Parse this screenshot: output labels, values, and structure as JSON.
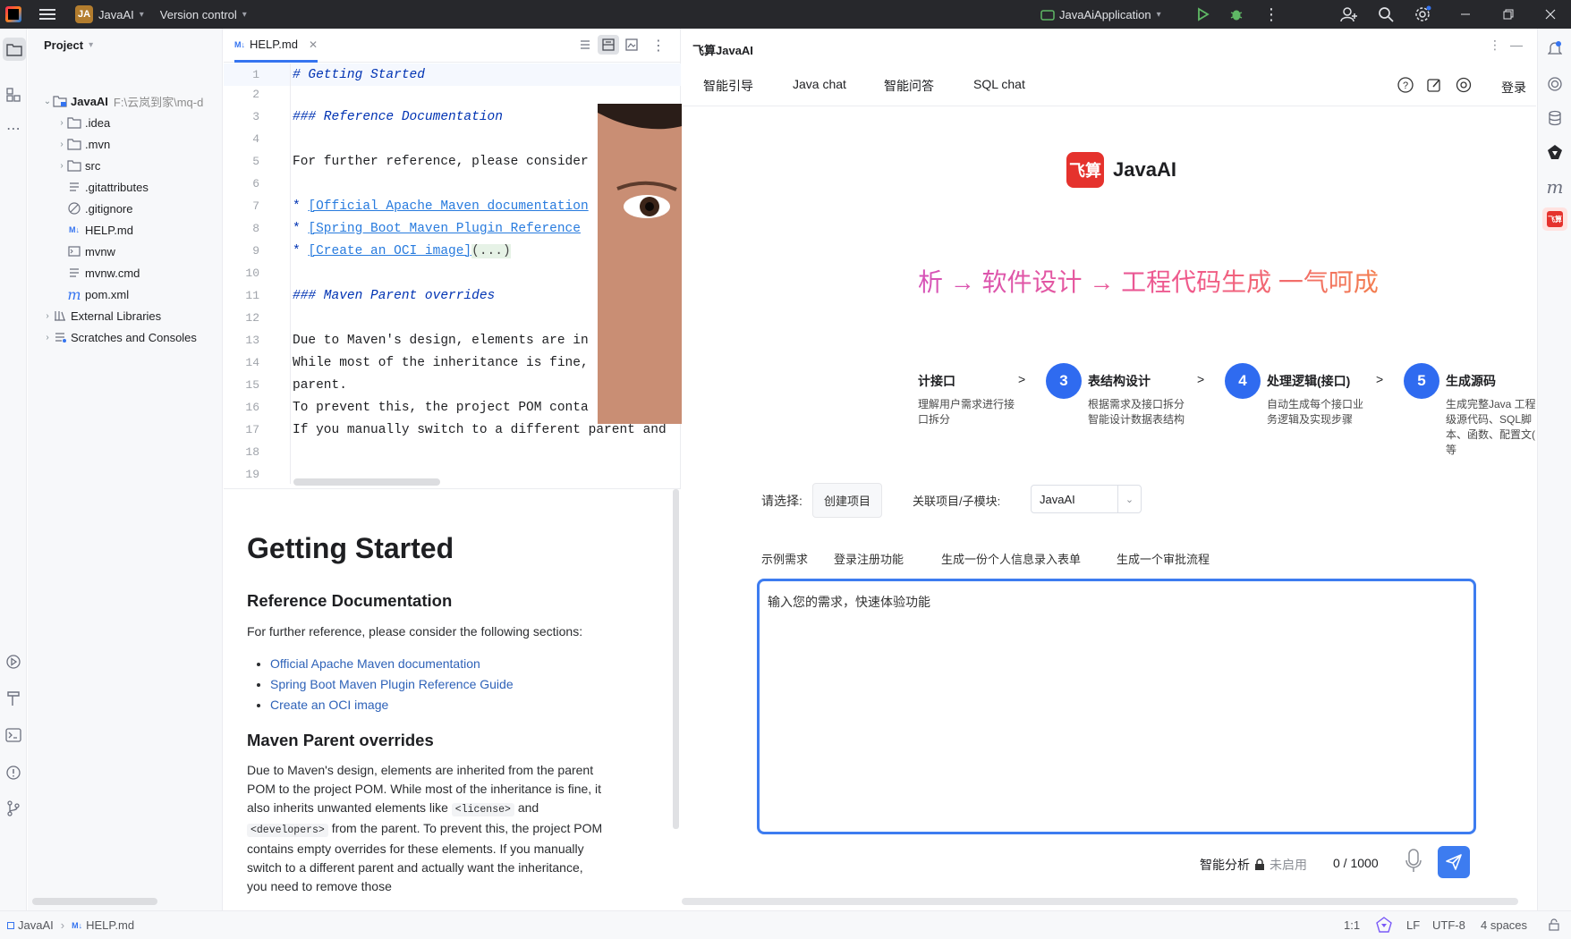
{
  "topbar": {
    "project_badge": "JA",
    "project_name": "JavaAI",
    "vcs_label": "Version control",
    "run_config": "JavaAiApplication"
  },
  "project_panel": {
    "title": "Project",
    "root_name": "JavaAI",
    "root_path": "F:\\云岚到家\\mq-d",
    "items": [
      {
        "label": ".idea"
      },
      {
        "label": ".mvn"
      },
      {
        "label": "src"
      },
      {
        "label": ".gitattributes"
      },
      {
        "label": ".gitignore"
      },
      {
        "label": "HELP.md"
      },
      {
        "label": "mvnw"
      },
      {
        "label": "mvnw.cmd"
      },
      {
        "label": "pom.xml"
      },
      {
        "label": "External Libraries"
      },
      {
        "label": "Scratches and Consoles"
      }
    ]
  },
  "editor": {
    "tab_label": "HELP.md",
    "tab_badge": "M↓",
    "lines": [
      {
        "n": "1",
        "text": "# Getting Started"
      },
      {
        "n": "2",
        "text": ""
      },
      {
        "n": "3",
        "text": "### Reference Documentation"
      },
      {
        "n": "4",
        "text": ""
      },
      {
        "n": "5",
        "text": "For further reference, please consider"
      },
      {
        "n": "6",
        "text": ""
      },
      {
        "n": "7",
        "bullet": "* ",
        "text": "[Official Apache Maven documentation"
      },
      {
        "n": "8",
        "bullet": "* ",
        "text": "[Spring Boot Maven Plugin Reference"
      },
      {
        "n": "9",
        "bullet": "* ",
        "text": "[Create an OCI image]",
        "tail": "(...)"
      },
      {
        "n": "10",
        "text": ""
      },
      {
        "n": "11",
        "text": "### Maven Parent overrides"
      },
      {
        "n": "12",
        "text": ""
      },
      {
        "n": "13",
        "text": "Due to Maven's design, elements are in"
      },
      {
        "n": "14",
        "text": "While most of the inheritance is fine,"
      },
      {
        "n": "15",
        "text": "parent."
      },
      {
        "n": "16",
        "text": "To prevent this, the project POM conta"
      },
      {
        "n": "17",
        "text": "If you manually switch to a different parent and"
      },
      {
        "n": "18",
        "text": ""
      },
      {
        "n": "19",
        "text": ""
      }
    ]
  },
  "preview": {
    "h1": "Getting Started",
    "h2_ref": "Reference Documentation",
    "p_ref": "For further reference, please consider the following sections:",
    "links": [
      "Official Apache Maven documentation",
      "Spring Boot Maven Plugin Reference Guide",
      "Create an OCI image"
    ],
    "h2_maven": "Maven Parent overrides",
    "p_maven_1": "Due to Maven's design, elements are inherited from the parent POM to the project POM. While most of the inheritance is fine, it also inherits unwanted elements like",
    "code_license": "<license>",
    "and": "and",
    "code_developers": "<developers>",
    "p_maven_2": "from the parent. To prevent this, the project POM contains empty overrides for these elements. If you manually switch to a different parent and actually want the inheritance, you need to remove those"
  },
  "ai_panel": {
    "title": "飞算JavaAI",
    "tabs": [
      "智能引导",
      "Java chat",
      "智能问答",
      "SQL chat"
    ],
    "login": "登录",
    "brand_logo_text": "飞算",
    "brand_name": "JavaAI",
    "slogan": "析 → 软件设计 → 工程代码生成 一气呵成",
    "steps": [
      {
        "num": "",
        "title": "计接口",
        "desc": "理解用户需求进行接\n口拆分"
      },
      {
        "num": "3",
        "title": "表结构设计",
        "desc": "根据需求及接口拆分\n智能设计数据表结构"
      },
      {
        "num": "4",
        "title": "处理逻辑(接口)",
        "desc": "自动生成每个接口业\n务逻辑及实现步骤"
      },
      {
        "num": "5",
        "title": "生成源码",
        "desc": "生成完整Java 工程\n级源代码、SQL脚\n本、函数、配置文(\n等"
      }
    ],
    "step_arrow": ">",
    "select_label": "请选择:",
    "create_project": "创建项目",
    "module_label": "关联项目/子模块:",
    "module_value": "JavaAI",
    "examples_label": "示例需求",
    "examples": [
      "登录注册功能",
      "生成一份个人信息录入表单",
      "生成一个审批流程"
    ],
    "input_placeholder": "输入您的需求，快速体验功能",
    "smart_analysis": "智能分析",
    "disabled": "未启用",
    "counter": "0 / 1000"
  },
  "statusbar": {
    "crumb_project": "JavaAI",
    "crumb_file": "HELP.md",
    "position": "1:1",
    "line_sep": "LF",
    "encoding": "UTF-8",
    "indent": "4 spaces"
  },
  "colors": {
    "accent": "#2f6bf0",
    "slogan": "#e85aa8",
    "brand_red": "#e5322d"
  }
}
